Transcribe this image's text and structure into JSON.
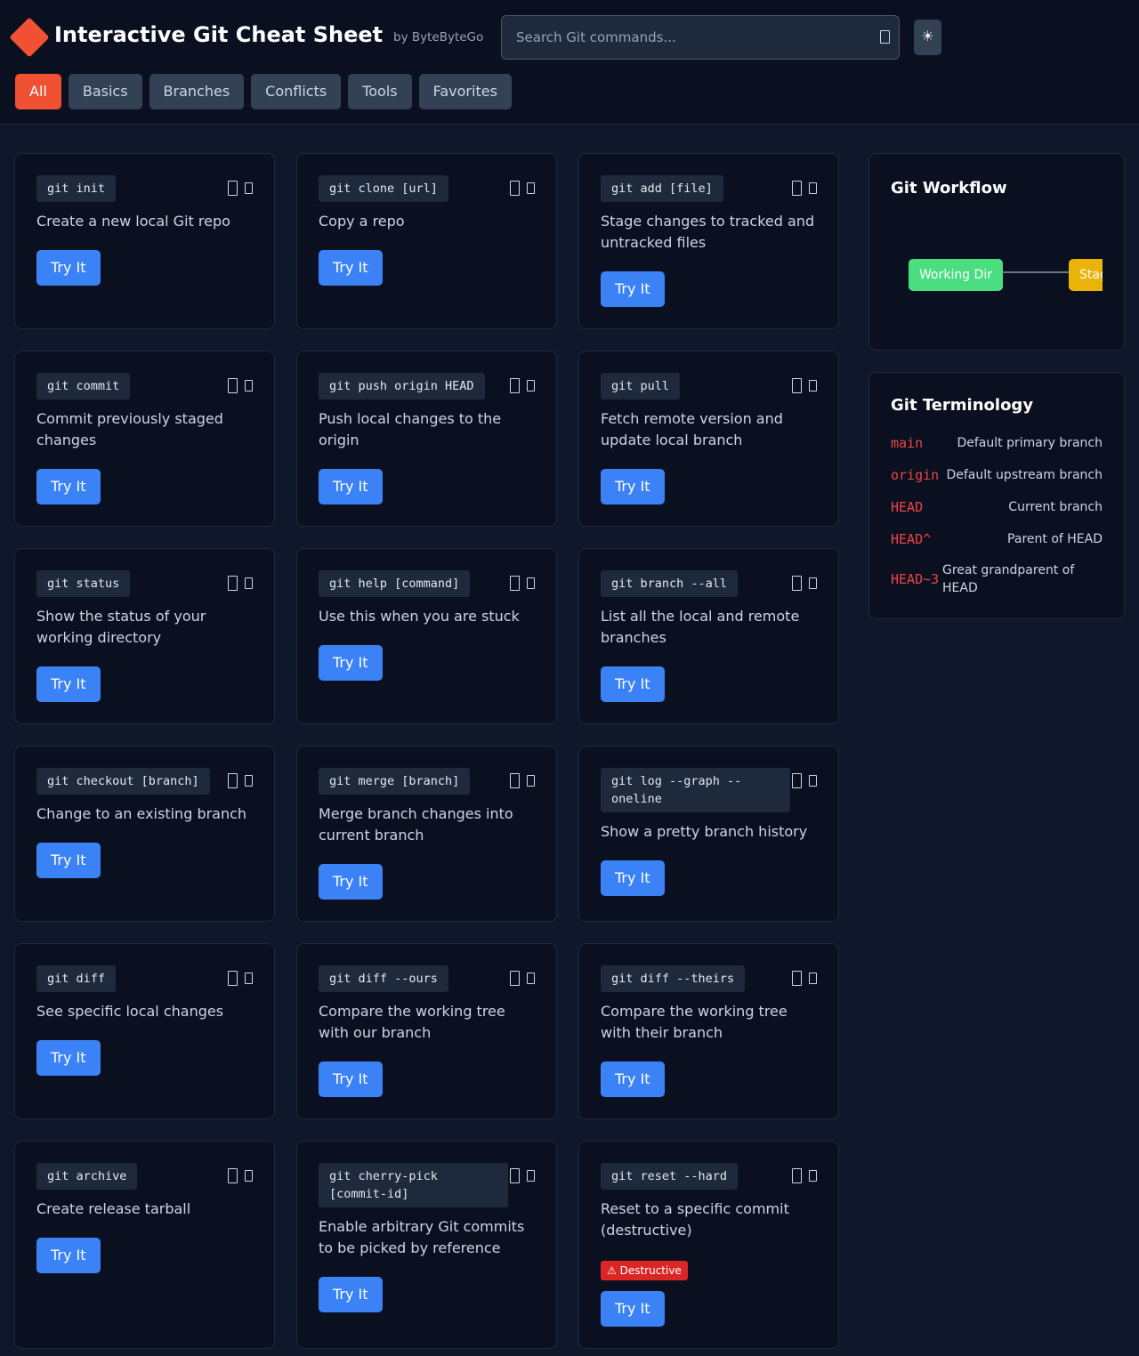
{
  "header": {
    "title": "Interactive Git Cheat Sheet",
    "byline": "by ByteByteGo",
    "search_placeholder": "Search Git commands...",
    "theme_toggle": "☀",
    "colors": {
      "brand": "#f05033",
      "accent": "#3b82f6",
      "background": "#0f172a"
    }
  },
  "tabs": [
    {
      "label": "All",
      "active": true
    },
    {
      "label": "Basics",
      "active": false
    },
    {
      "label": "Branches",
      "active": false
    },
    {
      "label": "Conflicts",
      "active": false
    },
    {
      "label": "Tools",
      "active": false
    },
    {
      "label": "Favorites",
      "active": false
    }
  ],
  "card_icons": [
    "copy-icon",
    "bookmark-icon"
  ],
  "cards": [
    {
      "command": "git init",
      "description": "Create a new local Git repo",
      "button": "Try It"
    },
    {
      "command": "git clone [url]",
      "description": "Copy a repo",
      "button": "Try It"
    },
    {
      "command": "git add [file]",
      "description": "Stage changes to tracked and untracked files",
      "button": "Try It"
    },
    {
      "command": "git commit",
      "description": "Commit previously staged changes",
      "button": "Try It"
    },
    {
      "command": "git push origin HEAD",
      "description": "Push local changes to the origin",
      "button": "Try It"
    },
    {
      "command": "git pull",
      "description": "Fetch remote version and update local branch",
      "button": "Try It"
    },
    {
      "command": "git status",
      "description": "Show the status of your working directory",
      "button": "Try It"
    },
    {
      "command": "git help [command]",
      "description": "Use this when you are stuck",
      "button": "Try It"
    },
    {
      "command": "git branch --all",
      "description": "List all the local and remote branches",
      "button": "Try It"
    },
    {
      "command": "git checkout [branch]",
      "description": "Change to an existing branch",
      "button": "Try It"
    },
    {
      "command": "git merge [branch]",
      "description": "Merge branch changes into current branch",
      "button": "Try It"
    },
    {
      "command": "git log --graph --oneline",
      "description": "Show a pretty branch history",
      "button": "Try It"
    },
    {
      "command": "git diff",
      "description": "See specific local changes",
      "button": "Try It"
    },
    {
      "command": "git diff --ours",
      "description": "Compare the working tree with our branch",
      "button": "Try It"
    },
    {
      "command": "git diff --theirs",
      "description": "Compare the working tree with their branch",
      "button": "Try It"
    },
    {
      "command": "git archive",
      "description": "Create release tarball",
      "button": "Try It"
    },
    {
      "command": "git cherry-pick [commit-id]",
      "description": "Enable arbitrary Git commits to be picked by reference",
      "button": "Try It"
    },
    {
      "command": "git reset --hard",
      "description": "Reset to a specific commit (destructive)",
      "badge": "⚠ Destructive",
      "button": "Try It"
    }
  ],
  "workflow": {
    "title": "Git Workflow",
    "stages": [
      {
        "label": "Working Dir",
        "color": "#4ade80"
      },
      {
        "label": "Staging",
        "color": "#eab308"
      }
    ]
  },
  "terminology": {
    "title": "Git Terminology",
    "items": [
      {
        "term": "main",
        "definition": "Default primary branch"
      },
      {
        "term": "origin",
        "definition": "Default upstream branch"
      },
      {
        "term": "HEAD",
        "definition": "Current branch"
      },
      {
        "term": "HEAD^",
        "definition": "Parent of HEAD"
      },
      {
        "term": "HEAD~3",
        "definition": "Great grandparent of HEAD"
      }
    ]
  }
}
